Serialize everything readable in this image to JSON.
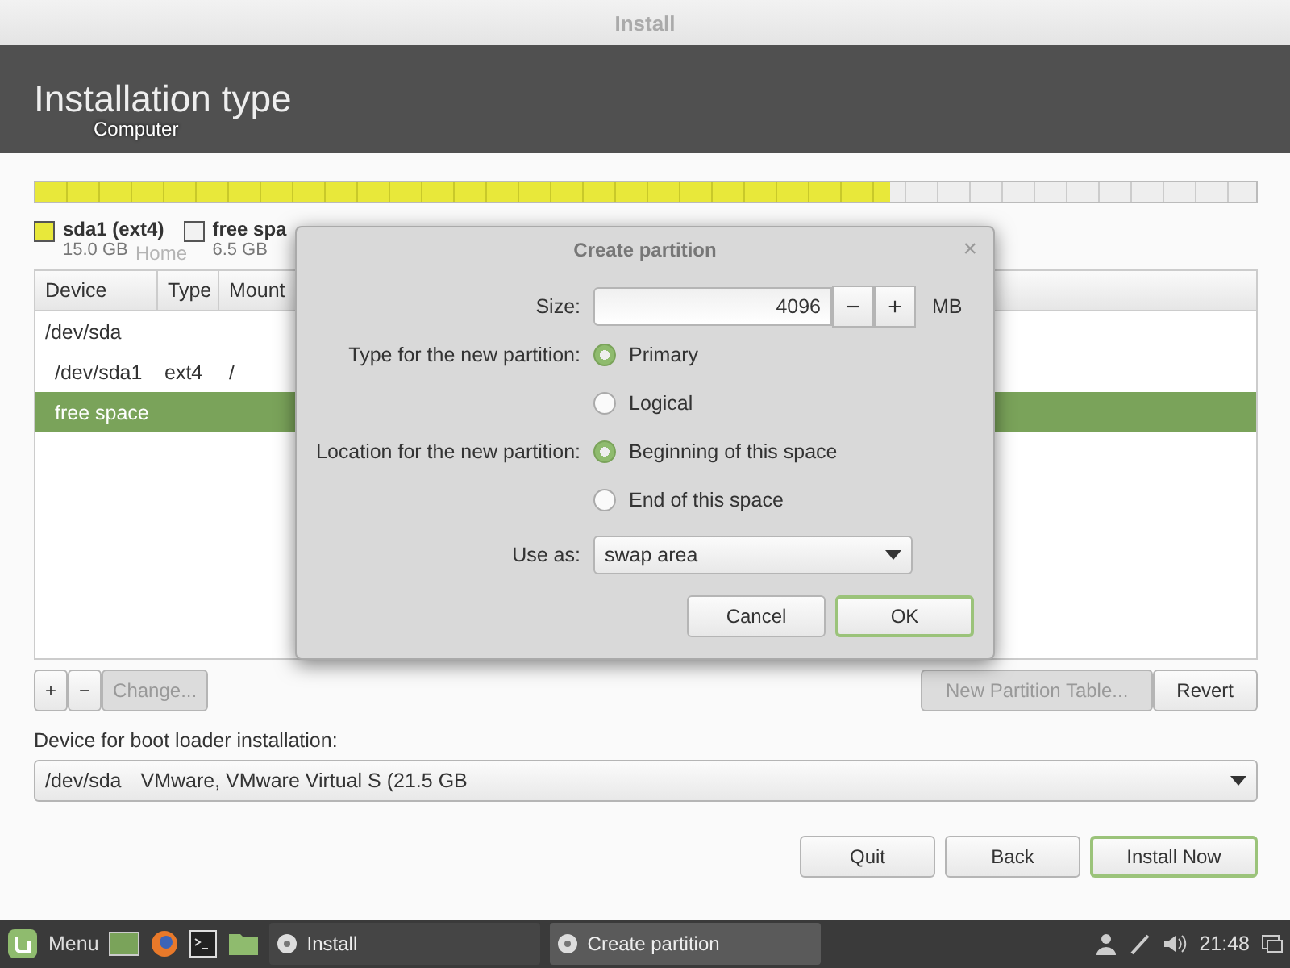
{
  "window": {
    "title": "Install"
  },
  "header": {
    "title": "Installation type"
  },
  "desktop_labels": [
    "Computer",
    "Home"
  ],
  "partition_bar": {
    "level": 0.7
  },
  "legend": [
    {
      "name": "sda1 (ext4)",
      "size": "15.0 GB",
      "color": "#e8e83a"
    },
    {
      "name": "free spa",
      "size": "6.5 GB",
      "color": "#f2f2f2"
    }
  ],
  "table": {
    "columns": [
      "Device",
      "Type",
      "Mount"
    ],
    "rows": [
      {
        "device": "/dev/sda",
        "type": "",
        "mount": "",
        "indent": false,
        "selected": false
      },
      {
        "device": "/dev/sda1",
        "type": "ext4",
        "mount": "/",
        "indent": true,
        "selected": false
      },
      {
        "device": "free space",
        "type": "",
        "mount": "",
        "indent": true,
        "selected": true
      }
    ]
  },
  "tools": [
    {
      "label": "+",
      "disabled": false
    },
    {
      "label": "−",
      "disabled": false
    },
    {
      "label": "Change...",
      "disabled": true
    }
  ],
  "table_buttons": [
    {
      "label": "New Partition Table...",
      "disabled": true
    },
    {
      "label": "Revert",
      "disabled": false
    }
  ],
  "bootloader": {
    "label": "Device for boot loader installation:",
    "device": "/dev/sda",
    "description": "VMware, VMware Virtual S (21.5 GB"
  },
  "buttons": [
    {
      "label": "Quit",
      "default": false
    },
    {
      "label": "Back",
      "default": false
    },
    {
      "label": "Install Now",
      "default": true
    }
  ],
  "dialog": {
    "title": "Create partition",
    "close": "×",
    "size_label": "Size:",
    "size": "4096",
    "minus": "−",
    "plus": "+",
    "unit": "MB",
    "type_label": "Type for the new partition:",
    "types": [
      {
        "label": "Primary",
        "selected": true
      },
      {
        "label": "Logical",
        "selected": false
      }
    ],
    "location_label": "Location for the new partition:",
    "locations": [
      {
        "label": "Beginning of this space",
        "selected": true
      },
      {
        "label": "End of this space",
        "selected": false
      }
    ],
    "use_label": "Use as:",
    "use": "swap area",
    "buttons": [
      {
        "label": "Cancel",
        "default": false
      },
      {
        "label": "OK",
        "default": true
      }
    ]
  },
  "taskbar": {
    "menu": "Menu",
    "tasks": [
      {
        "label": "Install",
        "selected": false
      },
      {
        "label": "Create partition",
        "selected": true
      }
    ],
    "time": "21:48"
  }
}
